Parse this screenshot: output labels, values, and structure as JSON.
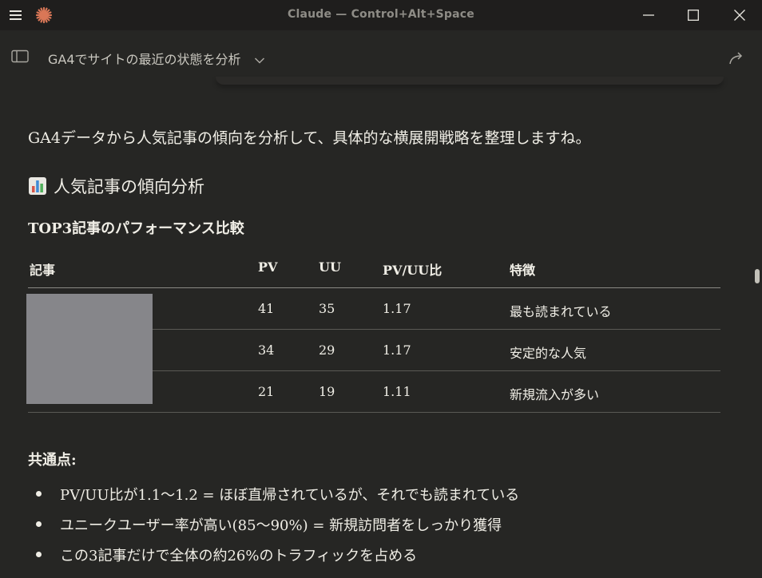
{
  "window": {
    "title": "Claude — Control+Alt+Space"
  },
  "header": {
    "chat_title": "GA4でサイトの最近の状態を分析"
  },
  "message": {
    "intro": "GA4データから人気記事の傾向を分析して、具体的な横展開戦略を整理しますね。",
    "heading": "人気記事の傾向分析",
    "subheading": "TOP3記事のパフォーマンス比較",
    "table": {
      "columns": [
        "記事",
        "PV",
        "UU",
        "PV/UU比",
        "特徴"
      ],
      "rows": [
        {
          "pv": "41",
          "uu": "35",
          "ratio": "1.17",
          "feature": "最も読まれている"
        },
        {
          "pv": "34",
          "uu": "29",
          "ratio": "1.17",
          "feature": "安定的な人気"
        },
        {
          "pv": "21",
          "uu": "19",
          "ratio": "1.11",
          "feature": "新規流入が多い"
        }
      ]
    },
    "common_label": "共通点:",
    "bullets": [
      "PV/UU比が1.1〜1.2 = ほぼ直帰されているが、それでも読まれている",
      "ユニークユーザー率が高い(85〜90%) = 新規訪問者をしっかり獲得",
      "この3記事だけで全体の約26%のトラフィックを占める"
    ]
  },
  "colors": {
    "background": "#262624",
    "titlebar": "#1f1e1d",
    "text": "#f0eee6",
    "accent": "#d97757",
    "redaction": "#86868a"
  },
  "icons": [
    "menu-icon",
    "claude-logo-icon",
    "minimize-icon",
    "maximize-icon",
    "close-icon",
    "sidebar-toggle-icon",
    "chevron-down-icon",
    "share-icon",
    "bar-chart-emoji-icon"
  ]
}
